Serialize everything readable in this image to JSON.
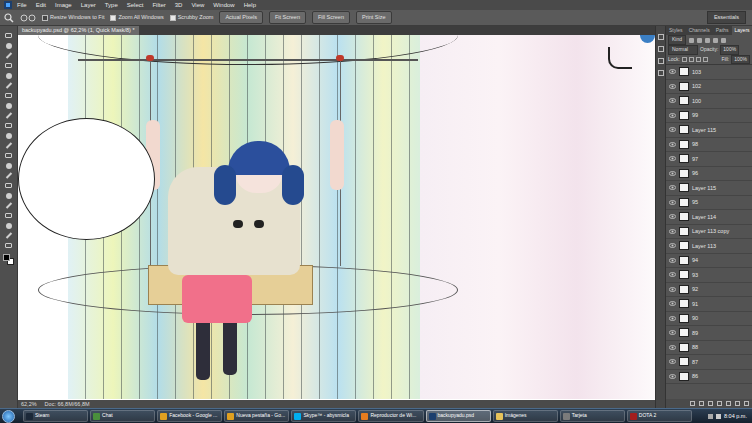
{
  "menu_bar": {
    "items": [
      "File",
      "Edit",
      "Image",
      "Layer",
      "Type",
      "Select",
      "Filter",
      "3D",
      "View",
      "Window",
      "Help"
    ]
  },
  "options_bar": {
    "checkboxes": [
      {
        "label": "Resize Windows to Fit",
        "checked": false
      },
      {
        "label": "Zoom All Windows",
        "checked": true
      },
      {
        "label": "Scrubby Zoom",
        "checked": true
      }
    ],
    "buttons": [
      "Actual Pixels",
      "Fit Screen",
      "Fill Screen",
      "Print Size"
    ],
    "workspace": "Essentials"
  },
  "document": {
    "tab_title": "backupyadu.psd @ 62,2% (1, Quick Mask/8) *"
  },
  "status_bar": {
    "zoom": "62,2%",
    "doc": "Doc: 66,8M/66,8M"
  },
  "layers_panel": {
    "tabs": [
      {
        "label": "Styles",
        "selected": false
      },
      {
        "label": "Channels",
        "selected": false
      },
      {
        "label": "Paths",
        "selected": false
      },
      {
        "label": "Layers",
        "selected": true
      }
    ],
    "filter": "Kind",
    "blend_mode": "Normal",
    "opacity_label": "Opacity:",
    "opacity": "100%",
    "lock_label": "Lock:",
    "fill_label": "Fill:",
    "fill": "100%",
    "layers": [
      {
        "name": "103",
        "visible": true
      },
      {
        "name": "102",
        "visible": true
      },
      {
        "name": "100",
        "visible": true
      },
      {
        "name": "99",
        "visible": true
      },
      {
        "name": "Layer 115",
        "visible": true
      },
      {
        "name": "98",
        "visible": true
      },
      {
        "name": "97",
        "visible": true
      },
      {
        "name": "96",
        "visible": true
      },
      {
        "name": "Layer 115",
        "visible": true
      },
      {
        "name": "95",
        "visible": true
      },
      {
        "name": "Layer 114",
        "visible": true
      },
      {
        "name": "Layer 113 copy",
        "visible": true
      },
      {
        "name": "Layer 113",
        "visible": true
      },
      {
        "name": "94",
        "visible": true
      },
      {
        "name": "93",
        "visible": true
      },
      {
        "name": "92",
        "visible": true
      },
      {
        "name": "91",
        "visible": true
      },
      {
        "name": "90",
        "visible": true
      },
      {
        "name": "89",
        "visible": true
      },
      {
        "name": "88",
        "visible": true
      },
      {
        "name": "87",
        "visible": true
      },
      {
        "name": "86",
        "visible": true
      }
    ]
  },
  "taskbar": {
    "items": [
      {
        "label": "Steam",
        "selected": false
      },
      {
        "label": "Chat",
        "selected": false
      },
      {
        "label": "Facebook - Google ...",
        "selected": false
      },
      {
        "label": "Nueva pestaña - Go...",
        "selected": false
      },
      {
        "label": "Skype™ - abysmicla",
        "selected": false
      },
      {
        "label": "Reproductor de Wi...",
        "selected": false
      },
      {
        "label": "backupyadu.psd",
        "selected": true
      },
      {
        "label": "Imágenes",
        "selected": false
      },
      {
        "label": "Tarjeta",
        "selected": false
      },
      {
        "label": "DOTA 2",
        "selected": false
      }
    ],
    "clock": "8:04 p.m."
  }
}
